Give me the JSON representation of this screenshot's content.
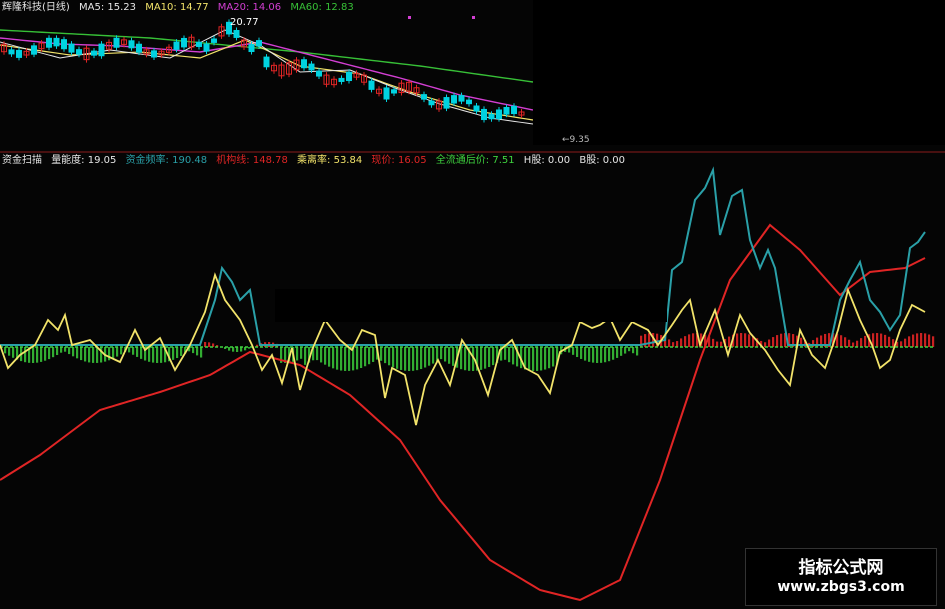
{
  "colors": {
    "white": "#e6e6e6",
    "yellow": "#f2e36a",
    "magenta": "#d33fd3",
    "green": "#37c037",
    "cyan": "#2aa0a8",
    "red": "#e02525",
    "lime": "#3fd43f",
    "candle_cyan": "#00d2e0"
  },
  "top_panel": {
    "legend": {
      "title": "辉隆科技(日线)",
      "ma5": "MA5: 15.23",
      "ma10": "MA10: 14.77",
      "ma20": "MA20: 14.06",
      "ma60": "MA60: 12.83"
    },
    "high_label": "20.77",
    "low_label": "←9.35"
  },
  "bottom_panel": {
    "legend": {
      "name": "资金扫描",
      "liang": "量能度: 19.05",
      "zijin": "资金频率: 190.48",
      "jigou": "机构线: 148.78",
      "chengli": "乘离率: 53.84",
      "xianjia": "现价: 16.05",
      "quanliu": "全流通后价: 7.51",
      "hgu": "H股: 0.00",
      "bgu": "B股: 0.00"
    }
  },
  "watermark": {
    "title": "指标公式网",
    "url": "www.zbgs3.com"
  }
}
